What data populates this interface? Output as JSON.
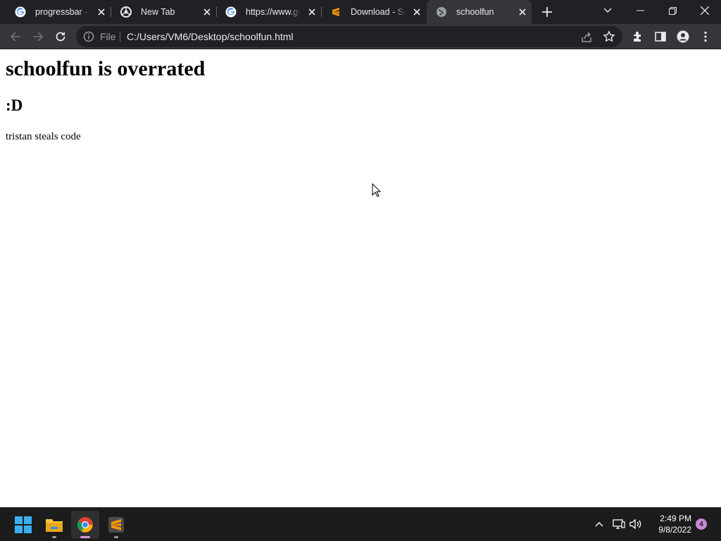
{
  "browser": {
    "tabs": [
      {
        "title": "progressbar - Go",
        "icon": "google-icon",
        "active": false
      },
      {
        "title": "New Tab",
        "icon": "chrome-icon",
        "active": false
      },
      {
        "title": "https://www.goo",
        "icon": "google-icon",
        "active": false
      },
      {
        "title": "Download - Sub",
        "icon": "sublime-icon",
        "active": false
      },
      {
        "title": "schoolfun",
        "icon": "globe-icon",
        "active": true
      }
    ],
    "omnibox": {
      "scheme_label": "File",
      "url": "C:/Users/VM6/Desktop/schoolfun.html"
    }
  },
  "page": {
    "heading1": "schoolfun is overrated",
    "heading2": ":D",
    "paragraph": "tristan steals code"
  },
  "taskbar": {
    "apps": [
      "windows-start-icon",
      "file-explorer-icon",
      "chrome-icon",
      "sublime-text-icon"
    ],
    "time": "2:49 PM",
    "date": "9/8/2022",
    "notification_count": "4"
  },
  "colors": {
    "titlebar": "#202124",
    "toolbar": "#35363a",
    "active_tab": "#35363a",
    "taskbar": "#1c1c1c",
    "notif_accent": "#c58ad0"
  }
}
